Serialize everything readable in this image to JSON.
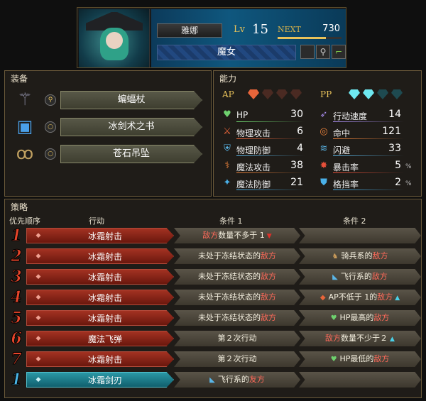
{
  "header": {
    "name": "雅娜",
    "lv_label": "Lv",
    "level": "15",
    "next_label": "NEXT",
    "next_value": "730",
    "next_progress_fraction": 0.75,
    "class": "魔女"
  },
  "equipment": {
    "title": "装备",
    "items": [
      {
        "name": "蝙蝠杖",
        "icon": "staff-icon",
        "slot_icon": "key-icon"
      },
      {
        "name": "冰剑术之书",
        "icon": "book-icon",
        "slot_icon": "ring-icon"
      },
      {
        "name": "苍石吊坠",
        "icon": "pendant-icon",
        "slot_icon": "ring-icon"
      }
    ]
  },
  "ability": {
    "title": "能力",
    "ap_label": "AP",
    "pp_label": "PP",
    "ap_filled": 1,
    "ap_total": 4,
    "pp_filled": 2,
    "pp_total": 4,
    "left": [
      {
        "label": "HP",
        "value": "30",
        "icon": "heart-icon",
        "color": "#6ed16e"
      },
      {
        "label": "物理攻击",
        "value": "6",
        "icon": "sword-icon",
        "color": "#e8653a"
      },
      {
        "label": "物理防御",
        "value": "4",
        "icon": "armor-icon",
        "color": "#5ab6e8"
      },
      {
        "label": "魔法攻击",
        "value": "38",
        "icon": "wand-icon",
        "color": "#e8803a"
      },
      {
        "label": "魔法防御",
        "value": "21",
        "icon": "magic-shield-icon",
        "color": "#4ab0e8"
      }
    ],
    "right": [
      {
        "label": "行动速度",
        "value": "14",
        "unit": "",
        "icon": "boot-icon",
        "color": "#a48ae8"
      },
      {
        "label": "命中",
        "value": "121",
        "unit": "",
        "icon": "target-icon",
        "color": "#e8803a"
      },
      {
        "label": "闪避",
        "value": "33",
        "unit": "",
        "icon": "dodge-icon",
        "color": "#5ab6e8"
      },
      {
        "label": "暴击率",
        "value": "5",
        "unit": "%",
        "icon": "crit-icon",
        "color": "#e8503a"
      },
      {
        "label": "格挡率",
        "value": "2",
        "unit": "%",
        "icon": "shield-icon",
        "color": "#4ab0e8"
      }
    ]
  },
  "strategy": {
    "title": "策略",
    "col_priority": "优先顺序",
    "col_action": "行动",
    "col_cond1": "条件 1",
    "col_cond2": "条件 2",
    "rows": [
      {
        "num": "1",
        "action": "冰霜射击",
        "c1": [
          "敌方",
          "数量不多于 1"
        ],
        "c1_mark": "down",
        "c2": [],
        "style": "red"
      },
      {
        "num": "2",
        "action": "冰霜射击",
        "c1": [
          "未处于冻结状态的",
          "敌方"
        ],
        "c2": [
          "骑兵系的",
          "敌方"
        ],
        "c2_icon": "cavalry-icon",
        "style": "red"
      },
      {
        "num": "3",
        "action": "冰霜射击",
        "c1": [
          "未处于冻结状态的",
          "敌方"
        ],
        "c2": [
          "飞行系的",
          "敌方"
        ],
        "c2_icon": "wing-icon",
        "style": "red"
      },
      {
        "num": "4",
        "action": "冰霜射击",
        "c1": [
          "未处于冻结状态的",
          "敌方"
        ],
        "c2": [
          "AP不低于 1",
          "的",
          "敌方"
        ],
        "c2_icon": "ap-gem-icon",
        "c2_mark": "up",
        "style": "red"
      },
      {
        "num": "5",
        "action": "冰霜射击",
        "c1": [
          "未处于冻结状态的",
          "敌方"
        ],
        "c2": [
          "HP最高的",
          "敌方"
        ],
        "c2_icon": "heart-icon",
        "style": "red"
      },
      {
        "num": "6",
        "action": "魔法飞弹",
        "c1": [
          "第２次行动"
        ],
        "c2": [
          "敌方",
          "数量不少于２"
        ],
        "c2_mark": "up",
        "style": "red"
      },
      {
        "num": "7",
        "action": "冰霜射击",
        "c1": [
          "第２次行动"
        ],
        "c2": [
          "HP最低的",
          "敌方"
        ],
        "c2_icon": "heart-icon",
        "style": "red"
      },
      {
        "num": "1",
        "action": "冰霜剑刃",
        "c1": [
          "飞行系的",
          "友方"
        ],
        "c1_icon": "wing-icon",
        "c2": [],
        "style": "teal"
      }
    ]
  }
}
